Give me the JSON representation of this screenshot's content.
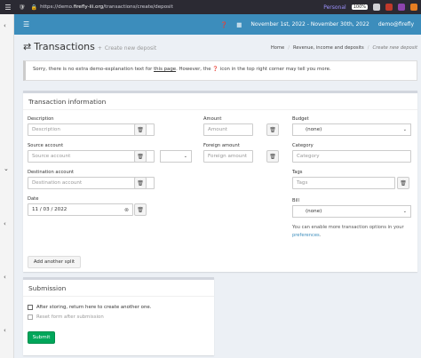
{
  "browser": {
    "url_prefix": "https://demo.",
    "url_domain": "firefly-iii.org",
    "url_path": "/transactions/create/deposit",
    "container": "Personal",
    "zoom": "100%"
  },
  "appbar": {
    "date_range": "November 1st, 2022 - November 30th, 2022",
    "user": "demo@firefly"
  },
  "header": {
    "title": "Transactions",
    "subtitle": "Create new deposit",
    "breadcrumbs": [
      "Home",
      "Revenue, income and deposits",
      "Create new deposit"
    ]
  },
  "callout": {
    "text_before": "Sorry, there is no extra demo-explanation text for ",
    "link": "this page",
    "text_after": ". However, the ",
    "text_end": " icon in the top right corner may tell you more."
  },
  "transaction": {
    "title": "Transaction information",
    "description_label": "Description",
    "description_placeholder": "Description",
    "source_label": "Source account",
    "source_placeholder": "Source account",
    "destination_label": "Destination account",
    "destination_placeholder": "Destination account",
    "date_label": "Date",
    "date_value": "11 / 03 / 2022",
    "amount_label": "Amount",
    "amount_placeholder": "Amount",
    "foreign_label": "Foreign amount",
    "foreign_placeholder": "Foreign amount",
    "budget_label": "Budget",
    "budget_value": "(none)",
    "category_label": "Category",
    "category_placeholder": "Category",
    "tags_label": "Tags",
    "tags_placeholder": "Tags",
    "bill_label": "Bill",
    "bill_value": "(none)",
    "help_text": "You can enable more transaction options in your",
    "help_link": "preferences",
    "help_end": ".",
    "add_split": "Add another split"
  },
  "submission": {
    "title": "Submission",
    "option_return": "After storing, return here to create another one.",
    "option_reset": "Reset form after submission",
    "submit": "Submit"
  }
}
